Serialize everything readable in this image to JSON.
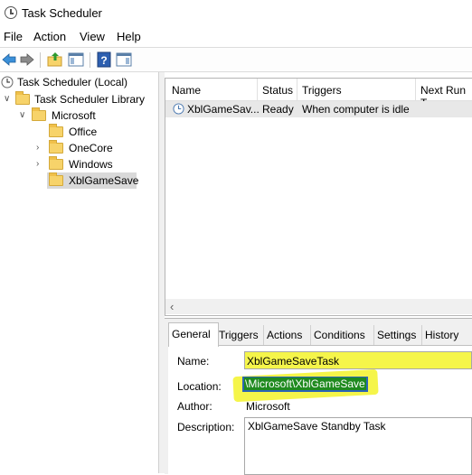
{
  "window": {
    "title": "Task Scheduler"
  },
  "menu": [
    "File",
    "Action",
    "View",
    "Help"
  ],
  "toolbar": {
    "icons": [
      "back-arrow-icon",
      "forward-arrow-icon",
      "up-folder-icon",
      "show-hide-console-tree-icon",
      "help-icon",
      "show-hide-action-pane-icon"
    ]
  },
  "tree": {
    "root": "Task Scheduler (Local)",
    "library": "Task Scheduler Library",
    "microsoft": "Microsoft",
    "children": [
      "Office",
      "OneCore",
      "Windows",
      "XblGameSave"
    ],
    "selected": "XblGameSave"
  },
  "task_list": {
    "columns": [
      "Name",
      "Status",
      "Triggers",
      "Next Run T"
    ],
    "rows": [
      {
        "name": "XblGameSav...",
        "status": "Ready",
        "triggers": "When computer is idle"
      }
    ]
  },
  "details": {
    "tabs": [
      "General",
      "Triggers",
      "Actions",
      "Conditions",
      "Settings",
      "History (d"
    ],
    "active_tab": "General",
    "name_label": "Name:",
    "name_value": "XblGameSaveTask",
    "location_label": "Location:",
    "location_value": "\\Microsoft\\XblGameSave",
    "author_label": "Author:",
    "author_value": "Microsoft",
    "description_label": "Description:",
    "description_value": "XblGameSave Standby Task"
  },
  "colors": {
    "highlight": "#f5f54a",
    "selection_blue": "#2c64b8",
    "selection_green": "#1f8a1f",
    "folder": "#f7d36a"
  }
}
